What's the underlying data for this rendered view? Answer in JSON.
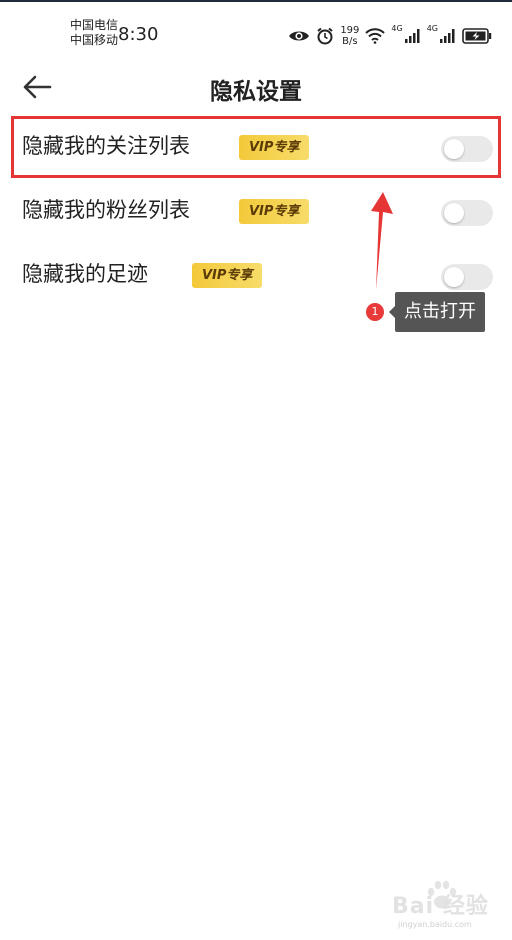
{
  "status_bar": {
    "carrier1": "中国电信",
    "carrier2": "中国移动",
    "time": "8:30",
    "net_speed_value": "199",
    "net_speed_unit": "B/s",
    "sig1_label": "4G",
    "sig2_label": "4G",
    "icons": [
      "eye-icon",
      "alarm-icon",
      "wifi-icon",
      "signal-icon",
      "signal-icon",
      "battery-charging-icon"
    ]
  },
  "header": {
    "title": "隐私设置",
    "back_icon": "arrow-left-icon"
  },
  "settings": [
    {
      "label": "隐藏我的关注列表",
      "badge": "VIP专享",
      "enabled": false
    },
    {
      "label": "隐藏我的粉丝列表",
      "badge": "VIP专享",
      "enabled": false
    },
    {
      "label": "隐藏我的足迹",
      "badge": "VIP专享",
      "enabled": false
    }
  ],
  "annotation": {
    "step_number": "1",
    "tooltip": "点击打开",
    "color": "#e53535"
  },
  "watermark": {
    "brand": "Bai 经验",
    "url": "jingyan.baidu.com"
  },
  "colors": {
    "vip_badge": "#f3c93a",
    "toggle_off": "#e9e9e9",
    "highlight": "#e53535",
    "tooltip_bg": "#555555"
  }
}
